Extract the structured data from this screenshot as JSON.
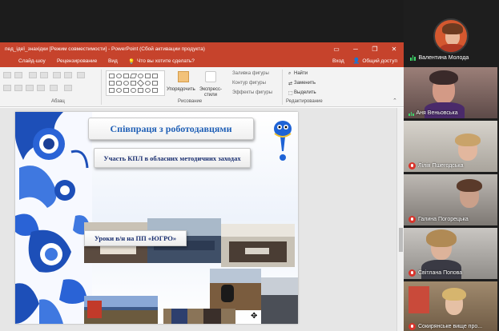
{
  "powerpoint": {
    "title": "пед_ідеї_знахідки [Режим совместимости] - PowerPoint (Сбой активации продукта)",
    "menu": {
      "slideshow": "Слайд-шоу",
      "review": "Рецензирование",
      "view": "Вид",
      "tellme": "Что вы хотите сделать?",
      "signin": "Вход",
      "share": "Общий доступ"
    },
    "ribbon": {
      "paragraph_group": "Абзац",
      "drawing_group": "Рисование",
      "editing_group": "Редактирование",
      "arrange": "Упорядочить",
      "quick_styles": "Экспресс-стили",
      "shape_fill": "Заливка фигуры",
      "shape_outline": "Контур фигуры",
      "shape_effects": "Эффекты фигуры",
      "find": "Найти",
      "replace": "Заменить",
      "select": "Выделить"
    },
    "slide": {
      "title": "Співпраця з роботодавцями",
      "subtitle": "Участь КПЛ в обласних методичних заходах",
      "lesson_caption": "Уроки в/н на ПП «ЮГРО»"
    }
  },
  "participants": {
    "active_speaker": "Валентина Молода",
    "tiles": [
      {
        "name": "Аня Веньовська",
        "muted": false
      },
      {
        "name": "Лілія Пшегодська",
        "muted": true
      },
      {
        "name": "Галина Погорецька",
        "muted": true
      },
      {
        "name": "Світлана Попова",
        "muted": true
      },
      {
        "name": "Сокирянське вище про...",
        "muted": true
      }
    ]
  },
  "colors": {
    "ppt_accent": "#c6432c",
    "slide_title": "#1f5fb6",
    "muted_red": "#d9342b",
    "speaking_green": "#3ed66b"
  }
}
